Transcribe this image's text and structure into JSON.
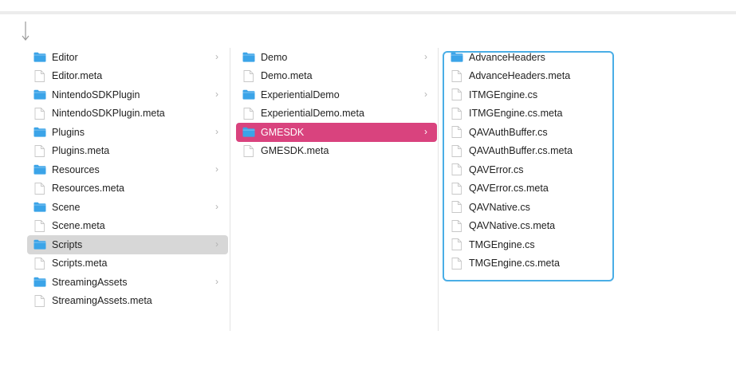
{
  "columns": [
    {
      "items": [
        {
          "label": "Editor",
          "type": "folder",
          "chevron": true
        },
        {
          "label": "Editor.meta",
          "type": "file"
        },
        {
          "label": "NintendoSDKPlugin",
          "type": "folder",
          "chevron": true
        },
        {
          "label": "NintendoSDKPlugin.meta",
          "type": "file"
        },
        {
          "label": "Plugins",
          "type": "folder",
          "chevron": true
        },
        {
          "label": "Plugins.meta",
          "type": "file"
        },
        {
          "label": "Resources",
          "type": "folder",
          "chevron": true
        },
        {
          "label": "Resources.meta",
          "type": "file"
        },
        {
          "label": "Scene",
          "type": "folder",
          "chevron": true
        },
        {
          "label": "Scene.meta",
          "type": "file"
        },
        {
          "label": "Scripts",
          "type": "folder",
          "chevron": true,
          "selected": "grey"
        },
        {
          "label": "Scripts.meta",
          "type": "file"
        },
        {
          "label": "StreamingAssets",
          "type": "folder",
          "chevron": true
        },
        {
          "label": "StreamingAssets.meta",
          "type": "file"
        }
      ]
    },
    {
      "items": [
        {
          "label": "Demo",
          "type": "folder",
          "chevron": true
        },
        {
          "label": "Demo.meta",
          "type": "file"
        },
        {
          "label": "ExperientialDemo",
          "type": "folder",
          "chevron": true
        },
        {
          "label": "ExperientialDemo.meta",
          "type": "file"
        },
        {
          "label": "GMESDK",
          "type": "folder",
          "chevron": true,
          "selected": "pink"
        },
        {
          "label": "GMESDK.meta",
          "type": "file"
        }
      ]
    },
    {
      "items": [
        {
          "label": "AdvanceHeaders",
          "type": "folder"
        },
        {
          "label": "AdvanceHeaders.meta",
          "type": "file"
        },
        {
          "label": "ITMGEngine.cs",
          "type": "file"
        },
        {
          "label": "ITMGEngine.cs.meta",
          "type": "file"
        },
        {
          "label": "QAVAuthBuffer.cs",
          "type": "file"
        },
        {
          "label": "QAVAuthBuffer.cs.meta",
          "type": "file"
        },
        {
          "label": "QAVError.cs",
          "type": "file"
        },
        {
          "label": "QAVError.cs.meta",
          "type": "file"
        },
        {
          "label": "QAVNative.cs",
          "type": "file"
        },
        {
          "label": "QAVNative.cs.meta",
          "type": "file"
        },
        {
          "label": "TMGEngine.cs",
          "type": "file"
        },
        {
          "label": "TMGEngine.cs.meta",
          "type": "file"
        }
      ]
    }
  ],
  "colors": {
    "folder": "#3ba4e8",
    "selection_pink": "#d9437e",
    "selection_grey": "#d7d7d7",
    "highlight_border": "#4aaee6"
  },
  "icons": {
    "folder": "folder-icon",
    "file": "document-icon",
    "chevron": "chevron-right-icon",
    "toolbar": "arrow-down-icon"
  }
}
